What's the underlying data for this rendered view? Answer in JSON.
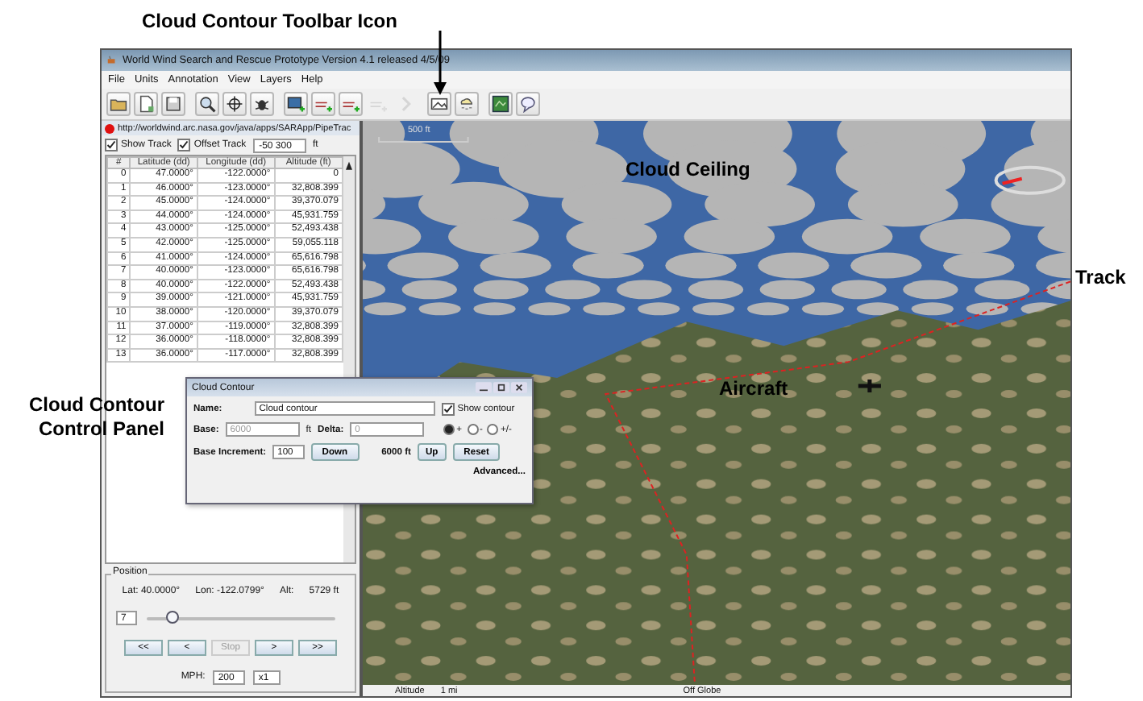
{
  "annotations": {
    "toolbar_icon_label": "Cloud Contour Toolbar Icon",
    "panel_label": "Cloud Contour Control Panel",
    "track_label": "Track",
    "cloud_ceiling_label": "Cloud Ceiling",
    "aircraft_label": "Aircraft"
  },
  "window": {
    "title": "World Wind Search and Rescue Prototype Version 4.1 released 4/5/09"
  },
  "menu": [
    "File",
    "Units",
    "Annotation",
    "View",
    "Layers",
    "Help"
  ],
  "toolbar": [
    {
      "items": [
        {
          "kind": "folder",
          "disabled": false
        },
        {
          "kind": "document",
          "disabled": false
        },
        {
          "kind": "disk",
          "disabled": false
        }
      ]
    },
    {
      "items": [
        {
          "kind": "magnifier",
          "disabled": false
        },
        {
          "kind": "crosshair",
          "disabled": false
        },
        {
          "kind": "bug",
          "disabled": false
        }
      ]
    },
    {
      "items": [
        {
          "kind": "screen-plus",
          "disabled": false
        },
        {
          "kind": "line-plus",
          "disabled": false
        },
        {
          "kind": "line-plus",
          "disabled": false
        },
        {
          "kind": "line-plus",
          "disabled": true
        },
        {
          "kind": "arrow",
          "disabled": true
        }
      ]
    },
    {
      "items": [
        {
          "kind": "picture",
          "disabled": false
        },
        {
          "kind": "cloud",
          "disabled": false
        }
      ]
    },
    {
      "items": [
        {
          "kind": "map",
          "disabled": false
        },
        {
          "kind": "speech",
          "disabled": false
        }
      ]
    }
  ],
  "track_panel": {
    "url": "http://worldwind.arc.nasa.gov/java/apps/SARApp/PipeTrac",
    "show_track": {
      "label": "Show Track",
      "checked": true
    },
    "offset_track": {
      "label": "Offset Track",
      "checked": true
    },
    "offset_value": "-50 300",
    "offset_unit": "ft",
    "table": {
      "columns": [
        "#",
        "Latitude (dd)",
        "Longitude (dd)",
        "Altitude (ft)"
      ],
      "rows": [
        [
          "0",
          "47.0000°",
          "-122.0000°",
          "0"
        ],
        [
          "1",
          "46.0000°",
          "-123.0000°",
          "32,808.399"
        ],
        [
          "2",
          "45.0000°",
          "-124.0000°",
          "39,370.079"
        ],
        [
          "3",
          "44.0000°",
          "-124.0000°",
          "45,931.759"
        ],
        [
          "4",
          "43.0000°",
          "-125.0000°",
          "52,493.438"
        ],
        [
          "5",
          "42.0000°",
          "-125.0000°",
          "59,055.118"
        ],
        [
          "6",
          "41.0000°",
          "-124.0000°",
          "65,616.798"
        ],
        [
          "7",
          "40.0000°",
          "-123.0000°",
          "65,616.798"
        ],
        [
          "8",
          "40.0000°",
          "-122.0000°",
          "52,493.438"
        ],
        [
          "9",
          "39.0000°",
          "-121.0000°",
          "45,931.759"
        ],
        [
          "10",
          "38.0000°",
          "-120.0000°",
          "39,370.079"
        ],
        [
          "11",
          "37.0000°",
          "-119.0000°",
          "32,808.399"
        ],
        [
          "12",
          "36.0000°",
          "-118.0000°",
          "32,808.399"
        ],
        [
          "13",
          "36.0000°",
          "-117.0000°",
          "32,808.399"
        ]
      ]
    }
  },
  "position": {
    "title": "Position",
    "lat": "Lat: 40.0000°",
    "lon": "Lon: -122.0799°",
    "alt_label": "Alt:",
    "alt_value": "5729 ft",
    "step": "7",
    "level": 0.13,
    "buttons": [
      {
        "label": "<<",
        "disabled": false
      },
      {
        "label": "<",
        "disabled": false
      },
      {
        "label": "Stop",
        "disabled": true
      },
      {
        "label": ">",
        "disabled": false
      },
      {
        "label": ">>",
        "disabled": false
      }
    ],
    "speed_label": "MPH:",
    "speed": "200",
    "multiplier": "x1"
  },
  "globe": {
    "scale": "500 ft",
    "status": {
      "altitude_label": "Altitude",
      "altitude": "1 mi",
      "position": "Off Globe"
    }
  },
  "dialog": {
    "title": "Cloud Contour",
    "name_label": "Name:",
    "name": "Cloud contour",
    "show_contour": {
      "label": "Show contour",
      "checked": true
    },
    "base_label": "Base:",
    "base": "6000",
    "base_unit": "ft",
    "delta_label": "Delta:",
    "delta": "0",
    "modes": [
      {
        "label": "+",
        "selected": true
      },
      {
        "label": "-",
        "selected": false
      },
      {
        "label": "+/-",
        "selected": false
      }
    ],
    "increment_label": "Base Increment:",
    "increment": "100",
    "down": "Down",
    "current": "6000 ft",
    "up": "Up",
    "reset": "Reset",
    "advanced": "Advanced..."
  }
}
